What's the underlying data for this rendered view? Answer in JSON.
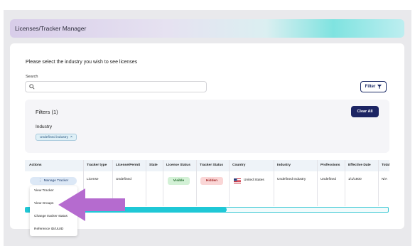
{
  "header": {
    "title": "Licenses/Tracker Manager"
  },
  "main": {
    "prompt": "Please select the industry you wish to see licenses",
    "search": {
      "label": "Search",
      "value": "",
      "placeholder": ""
    },
    "filter_button": "Filter",
    "filters": {
      "title": "Filters (1)",
      "clear_button": "Clear All",
      "group_label": "Industry",
      "chips": [
        "Undefined industry"
      ]
    }
  },
  "table": {
    "columns": [
      "Actions",
      "Tracker type",
      "License/Permit",
      "State",
      "License Status",
      "Tracker Status",
      "Country",
      "Industry",
      "Professions",
      "Effective Date",
      "Total"
    ],
    "row": {
      "action_button": "Manage Tracker",
      "tracker_type": "License",
      "license_permit": "Undefined",
      "state": "",
      "license_status": "Visible",
      "tracker_status": "Hidden",
      "country": "United States",
      "industry": "Undefined Industry",
      "professions": "Undefined",
      "effective_date": "1/1/1800",
      "total": "N/A"
    }
  },
  "action_menu": {
    "items": [
      "View Tracker",
      "View Groups",
      "Change tracker status",
      "Reference ID/UUID"
    ]
  },
  "colors": {
    "primary": "#1c2463",
    "accent": "#1fc8d6",
    "annotation_arrow": "#b56bcf"
  }
}
